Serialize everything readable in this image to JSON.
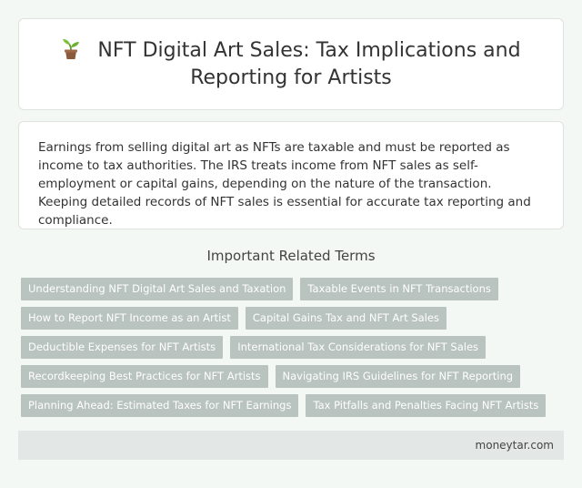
{
  "header": {
    "icon": "sprout-icon",
    "title": "NFT Digital Art Sales: Tax Implications and Reporting for Artists"
  },
  "summary": {
    "text": "Earnings from selling digital art as NFTs are taxable and must be reported as income to tax authorities. The IRS treats income from NFT sales as self-employment or capital gains, depending on the nature of the transaction. Keeping detailed records of NFT sales is essential for accurate tax reporting and compliance."
  },
  "related": {
    "heading": "Important Related Terms",
    "rows": [
      [
        "Understanding NFT Digital Art Sales and Taxation",
        "Taxable Events in NFT Transactions"
      ],
      [
        "How to Report NFT Income as an Artist",
        "Capital Gains Tax and NFT Art Sales"
      ],
      [
        "Deductible Expenses for NFT Artists",
        "International Tax Considerations for NFT Sales"
      ],
      [
        "Recordkeeping Best Practices for NFT Artists",
        "Navigating IRS Guidelines for NFT Reporting"
      ],
      [
        "Planning Ahead: Estimated Taxes for NFT Earnings",
        "Tax Pitfalls and Penalties Facing NFT Artists"
      ]
    ]
  },
  "footer": {
    "site": "moneytar.com"
  },
  "colors": {
    "background": "#f3f8f5",
    "tag": "#b9c3c0",
    "footer": "#e3e8e6"
  }
}
